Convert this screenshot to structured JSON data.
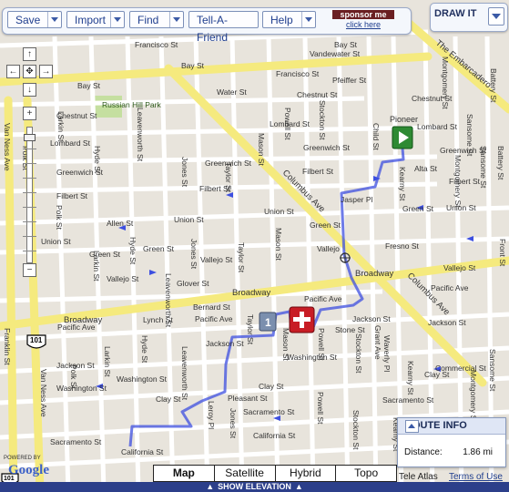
{
  "toolbar": {
    "buttons": [
      "Save",
      "Import",
      "Find",
      "Tell-A-Friend",
      "Help"
    ],
    "sponsor_title": "sponsor me",
    "sponsor_link": "click here"
  },
  "draw_it": {
    "label": "DRAW IT"
  },
  "map_types": [
    "Map",
    "Satellite",
    "Hybrid",
    "Topo"
  ],
  "elevation": {
    "label": "SHOW ELEVATION"
  },
  "route_info": {
    "title": "ROUTE INFO",
    "distance_label": "Distance:",
    "distance_value": "1.86 mi"
  },
  "attribution": {
    "powered_by": "POWERED BY",
    "logo": "Google",
    "tele_atlas": "Tele Atlas",
    "terms": "Terms of Use"
  },
  "markers": {
    "start_label": "Pioneer",
    "waypoint_number": "1"
  },
  "streets": {
    "francisco_1": "Francisco St",
    "francisco_2": "Francisco St",
    "bay_1": "Bay St",
    "bay_2": "Bay St",
    "bay_3": "Bay St",
    "chestnut_1": "Chestnut St",
    "chestnut_2": "Chestnut St",
    "chestnut_3": "Chestnut St",
    "water": "Water St",
    "pfeiffer": "Pfeiffer St",
    "lombard_1": "Lombard St",
    "lombard_2": "Lombard St",
    "lombard_3": "Lombard St",
    "greenwich_1": "Greenwich St",
    "greenwich_2": "Greenwich St",
    "greenwich_3": "Greenwich St",
    "greenwich_4": "Greenwich St",
    "filbert_1": "Filbert St",
    "filbert_2": "Filbert St",
    "filbert_3": "Filbert St",
    "filbert_4": "Filbert St",
    "union_1": "Union St",
    "union_2": "Union St",
    "union_3": "Union St",
    "union_4": "Union St",
    "allen": "Allen St",
    "green_1": "Green St",
    "green_2": "Green St",
    "green_3": "Green St",
    "green_4": "Green St",
    "vallejo_1": "Vallejo St",
    "vallejo_2": "Vallejo St",
    "vallejo_3": "Vallejo St",
    "glover": "Glover St",
    "broadway_1": "Broadway",
    "broadway_2": "Broadway",
    "broadway_3": "Broadway",
    "bernard": "Bernard St",
    "lynch": "Lynch St",
    "pacific_1": "Pacific Ave",
    "pacific_2": "Pacific Ave",
    "pacific_3": "Pacific Ave",
    "pacific_4": "Pacific Ave",
    "jackson_1": "Jackson St",
    "jackson_2": "Jackson St",
    "jackson_3": "Jackson St",
    "jackson_4": "Jackson St",
    "washington_1": "Washington St",
    "washington_2": "Washington St",
    "washington_3": "Washington St",
    "clay_1": "Clay St",
    "clay_2": "Clay St",
    "clay_3": "Clay St",
    "sacramento_1": "Sacramento St",
    "sacramento_2": "Sacramento St",
    "sacramento_3": "Sacramento St",
    "california_1": "California St",
    "california_2": "California St",
    "pleasant": "Pleasant St",
    "commercial": "Commercial St",
    "fresno": "Fresno St",
    "leavenworth_1": "Leavenworth St",
    "leavenworth_2": "Leavenworth St",
    "leavenworth_3": "Leavenworth St",
    "jones_1": "Jones St",
    "jones_2": "Jones St",
    "jones_3": "Jones St",
    "taylor_1": "Taylor St",
    "taylor_2": "Taylor St",
    "taylor_3": "Taylor St",
    "mason_1": "Mason St",
    "mason_2": "Mason St",
    "mason_3": "Mason St",
    "powell_1": "Powell St",
    "powell_2": "Powell St",
    "powell_3": "Powell St",
    "stockton_1": "Stockton St",
    "stockton_2": "Stockton St",
    "stockton_3": "Stockton St",
    "grant": "Grant Ave",
    "kearny_1": "Kearny St",
    "kearny_2": "Kearny St",
    "kearny_3": "Kearny St",
    "montgomery_1": "Montgomery St",
    "montgomery_2": "Montgomery St",
    "montgomery_3": "Montgomery St",
    "sansome_1": "Sansome St",
    "sansome_2": "Sansome St",
    "sansome_3": "Sansome St",
    "battery_1": "Battery St",
    "battery_2": "Battery St",
    "front": "Front St",
    "child": "Child St",
    "hyde_1": "Hyde St",
    "hyde_2": "Hyde St",
    "hyde_3": "Hyde St",
    "larkin_1": "Larkin St",
    "larkin_2": "Larkin St",
    "larkin_3": "Larkin St",
    "polk_1": "Polk St",
    "polk_2": "Polk St",
    "polk_3": "Polk St",
    "van_ness_1": "Van Ness Ave",
    "van_ness_2": "Van Ness Ave",
    "franklin": "Franklin St",
    "columbus_1": "Columbus Ave",
    "columbus_2": "Columbus Ave",
    "embarcadero": "The Embarcadero",
    "waverly": "Waverly Pl",
    "jasper": "Jasper Pl",
    "leroy": "Leroy Pl",
    "stone": "Stone St",
    "vandewater": "Vandewater St",
    "alta": "Alta St",
    "vallejo_pl": "Vallejo"
  },
  "places": {
    "park": "Russian Hill Park"
  },
  "shields": {
    "us101_1": "101",
    "us101_2": "101"
  }
}
